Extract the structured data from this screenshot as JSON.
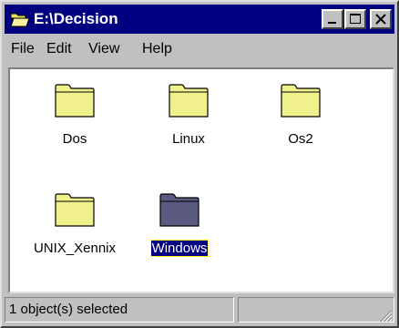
{
  "window": {
    "title": "E:\\Decision",
    "icon": "open-folder-icon",
    "caption_buttons": [
      "minimize-icon",
      "maximize-icon",
      "close-icon"
    ],
    "title_bar_color": "#000080"
  },
  "menu": {
    "file": "File",
    "edit": "Edit",
    "view": "View",
    "help": "Help"
  },
  "items": [
    {
      "name": "Dos",
      "icon": "folder-icon",
      "selected": false
    },
    {
      "name": "Linux",
      "icon": "folder-icon",
      "selected": false
    },
    {
      "name": "Os2",
      "icon": "folder-icon",
      "selected": false
    },
    {
      "name": "UNIX_Xennix",
      "icon": "folder-icon",
      "selected": false
    },
    {
      "name": "Windows",
      "icon": "folder-icon",
      "selected": true
    }
  ],
  "status": {
    "text": "1 object(s) selected",
    "right": ""
  },
  "colors": {
    "folder": "#f0f08c",
    "folder_selected": "#5a5a80",
    "selection": "#000080"
  }
}
